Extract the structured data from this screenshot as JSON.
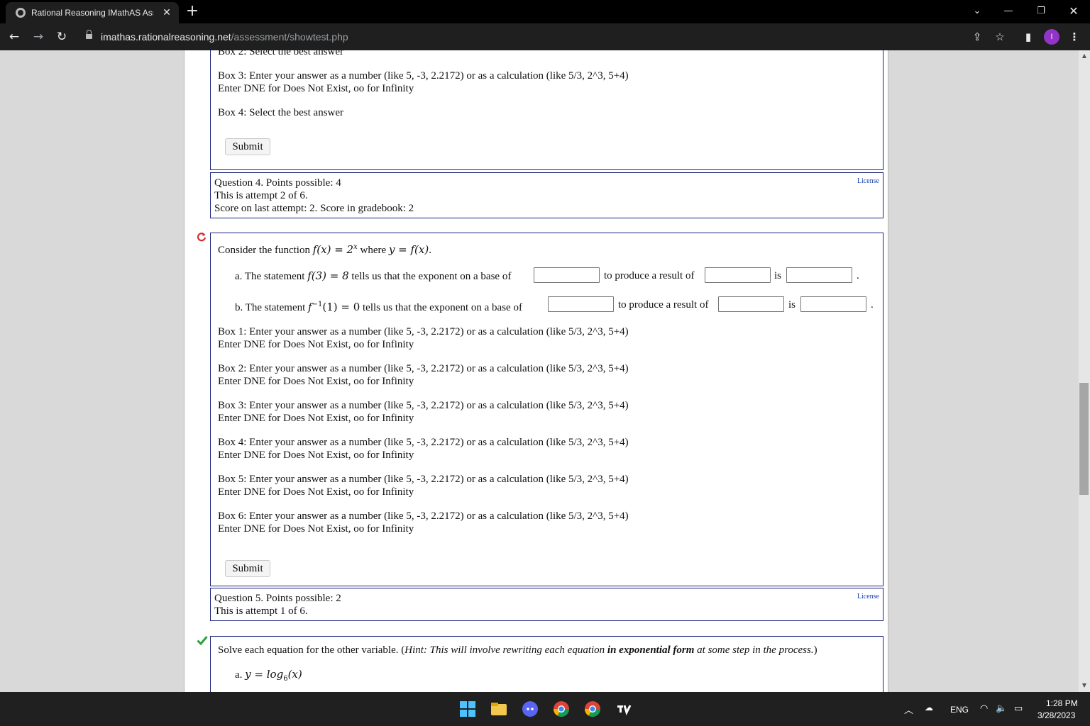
{
  "browser": {
    "tab_title": "Rational Reasoning IMathAS Asse",
    "tab_close": "✕",
    "new_tab": "+",
    "url_host": "imathas.rationalreasoning.net",
    "url_path": "/assessment/showtest.php"
  },
  "q3_tail": {
    "partial_line": "Box 2: Select the best answer",
    "box3_line1": "Box 3: Enter your answer as a number (like 5, -3, 2.2172) or as a calculation (like 5/3, 2^3, 5+4)",
    "box3_line2": "Enter DNE for Does Not Exist, oo for Infinity",
    "box4": "Box 4: Select the best answer",
    "submit": "Submit"
  },
  "q4": {
    "header_line1": "Question 4. Points possible: 4",
    "header_line2": "This is attempt 2 of 6.",
    "header_line3": "Score on last attempt: 2. Score in gradebook: 2",
    "license": "License",
    "intro_prefix": "Consider the function ",
    "intro_fn": "f(x) = 2",
    "intro_exp": "x",
    "intro_mid": " where ",
    "intro_y": "y = f(x)",
    "intro_end": ".",
    "a_prefix": "a. The statement ",
    "a_math": "f(3) = 8",
    "a_mid": " tells us that the exponent on a base of",
    "a_result": "to produce a result of",
    "a_is": "is",
    "a_end": ".",
    "b_prefix": "b. The statement ",
    "b_math_f": "f",
    "b_math_sup": "−1",
    "b_math_rest": "(1) = 0",
    "b_mid": " tells us that the exponent on a base of",
    "b_result": "to produce a result of",
    "b_is": "is",
    "b_end": ".",
    "boxes": [
      "Box 1: Enter your answer as a number (like 5, -3, 2.2172) or as a calculation (like 5/3, 2^3, 5+4)",
      "Box 2: Enter your answer as a number (like 5, -3, 2.2172) or as a calculation (like 5/3, 2^3, 5+4)",
      "Box 3: Enter your answer as a number (like 5, -3, 2.2172) or as a calculation (like 5/3, 2^3, 5+4)",
      "Box 4: Enter your answer as a number (like 5, -3, 2.2172) or as a calculation (like 5/3, 2^3, 5+4)",
      "Box 5: Enter your answer as a number (like 5, -3, 2.2172) or as a calculation (like 5/3, 2^3, 5+4)",
      "Box 6: Enter your answer as a number (like 5, -3, 2.2172) or as a calculation (like 5/3, 2^3, 5+4)"
    ],
    "box_hint": "Enter DNE for Does Not Exist, oo for Infinity",
    "submit": "Submit"
  },
  "q5": {
    "header_line1": "Question 5. Points possible: 2",
    "header_line2": "This is attempt 1 of 6.",
    "license": "License",
    "intro_prefix": "Solve each equation for the other variable. (",
    "intro_hint1": "Hint: This will involve rewriting each equation ",
    "intro_bold": "in exponential form",
    "intro_hint2": " at some step in the process.",
    "intro_end": ")",
    "a_prefix": "a. ",
    "a_math": "y = log",
    "a_sub": "6",
    "a_rest": "(x)"
  },
  "taskbar": {
    "lang": "ENG",
    "time": "1:28 PM",
    "date": "3/28/2023"
  },
  "colors": {
    "question_border": "#1a237e",
    "retry_icon": "#d32f2f",
    "correct_icon": "#2e9e3e",
    "profile": "#9334c9"
  }
}
